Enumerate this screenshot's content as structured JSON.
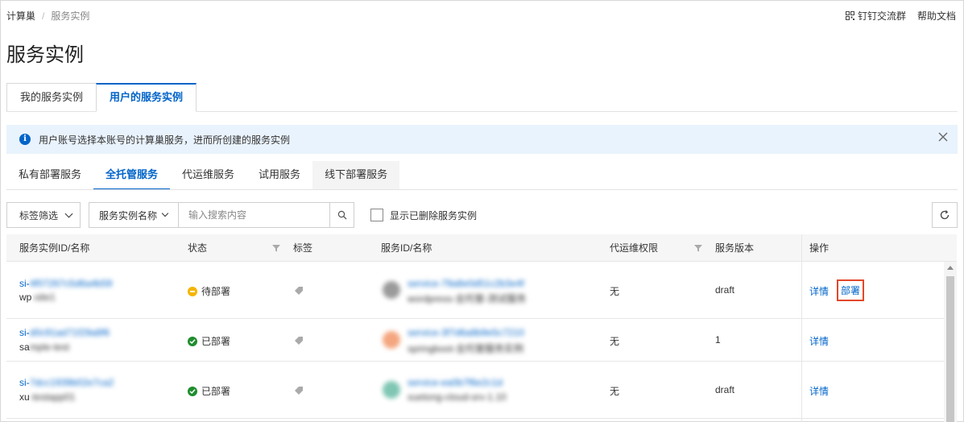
{
  "breadcrumb": {
    "root": "计算巢",
    "separator": "/",
    "current": "服务实例"
  },
  "top_links": {
    "dingtalk": "钉钉交流群",
    "help": "帮助文档"
  },
  "page_title": "服务实例",
  "main_tabs": [
    {
      "label": "我的服务实例",
      "active": false
    },
    {
      "label": "用户的服务实例",
      "active": true
    }
  ],
  "notice": {
    "text": "用户账号选择本账号的计算巢服务，进而所创建的服务实例"
  },
  "sub_tabs": [
    {
      "label": "私有部署服务",
      "active": false
    },
    {
      "label": "全托管服务",
      "active": true
    },
    {
      "label": "代运维服务",
      "active": false
    },
    {
      "label": "试用服务",
      "active": false
    },
    {
      "label": "线下部署服务",
      "active": false
    }
  ],
  "filters": {
    "tag_filter": "标签筛选",
    "search_field": "服务实例名称",
    "search_placeholder": "输入搜索内容",
    "show_deleted": "显示已删除服务实例"
  },
  "table": {
    "columns": {
      "instance": "服务实例ID/名称",
      "status": "状态",
      "tags": "标签",
      "service": "服务ID/名称",
      "ops_permission": "代运维权限",
      "version": "服务版本",
      "actions": "操作"
    },
    "rows": [
      {
        "id_prefix": "si-",
        "id_rest": "4f07267c5d6a4b59",
        "name_prefix": "wp",
        "name_rest": "-site1",
        "status": "待部署",
        "status_type": "pending",
        "service_id": "service-79a8e0d51c2b3e4f",
        "service_name": "wordpress-全托管-测试服务",
        "avatar_color": "#9a9a9a",
        "ops": "无",
        "version": "draft",
        "actions": [
          "详情",
          "部署"
        ]
      },
      {
        "id_prefix": "si-",
        "id_rest": "d0c91ad71f29a8f6",
        "name_prefix": "sa",
        "name_rest": "mple-test",
        "status": "已部署",
        "status_type": "done",
        "service_id": "service-3f7d6a8b9e5c7210",
        "service_name": "springboot-全托管服务实例",
        "avatar_color": "#f4a67f",
        "ops": "无",
        "version": "1",
        "actions": [
          "详情"
        ]
      },
      {
        "id_prefix": "si-",
        "id_rest": "7dcc1939b02e7ca2",
        "name_prefix": "xu",
        "name_rest": "-testapp01",
        "status": "已部署",
        "status_type": "done",
        "service_id": "service-ea0b7f6e2c1d",
        "service_name": "xuetong-cloud-srv-1.10",
        "avatar_color": "#7fc6b3",
        "ops": "无",
        "version": "draft",
        "actions": [
          "详情"
        ]
      }
    ]
  }
}
